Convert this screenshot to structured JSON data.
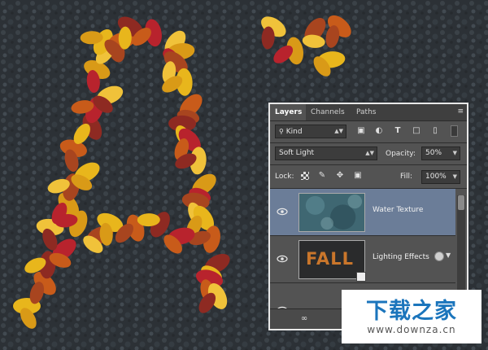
{
  "panel": {
    "tabs": [
      {
        "label": "Layers",
        "active": true
      },
      {
        "label": "Channels",
        "active": false
      },
      {
        "label": "Paths",
        "active": false
      }
    ],
    "filter": {
      "value": "Kind"
    },
    "blend_mode": {
      "value": "Soft Light"
    },
    "opacity": {
      "label": "Opacity:",
      "value": "50%"
    },
    "lock": {
      "label": "Lock:"
    },
    "fill": {
      "label": "Fill:",
      "value": "100%"
    },
    "layers": [
      {
        "name": "Water Texture",
        "selected": true,
        "visible": true
      },
      {
        "name": "Lighting Effects",
        "selected": false,
        "visible": true,
        "thumb_text": "FALL"
      }
    ]
  },
  "watermark": {
    "title": "下载之家",
    "url": "www.downza.cn"
  },
  "colors": {
    "panel_bg": "#535353",
    "selected_layer": "#6b7d98",
    "watermark_blue": "#1b75bc"
  }
}
